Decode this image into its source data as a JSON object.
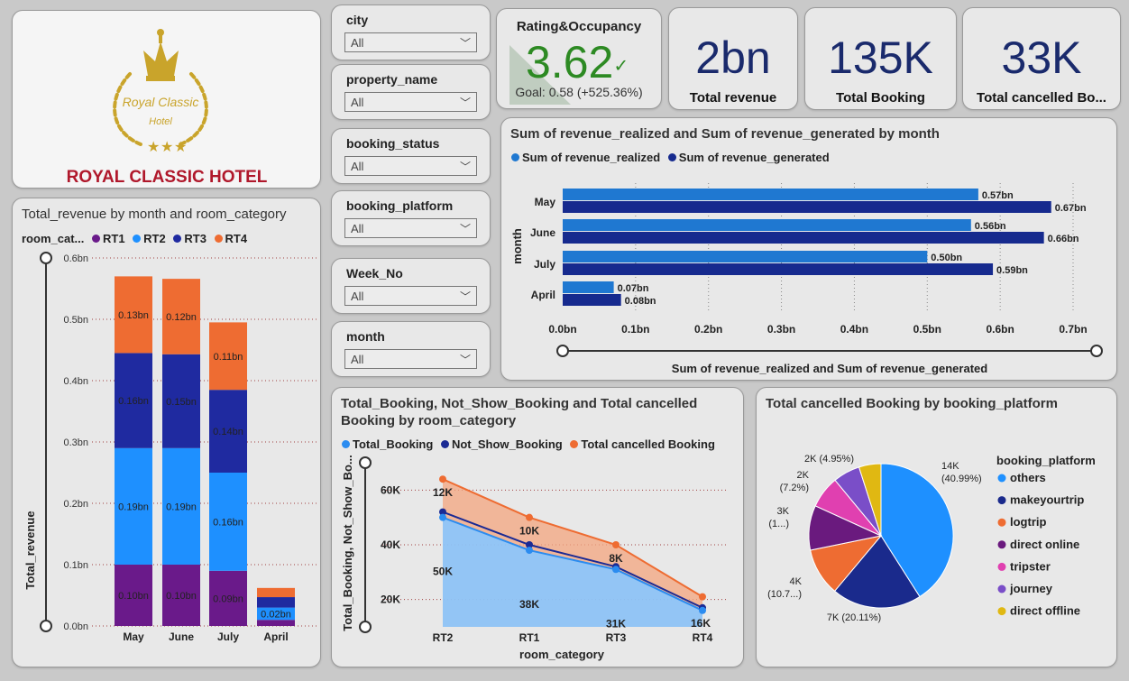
{
  "logo": {
    "brand": "ROYAL CLASSIC HOTEL",
    "emblem_line1": "Royal Classic",
    "emblem_line2": "Hotel",
    "colors": {
      "gold": "#c9a42b",
      "red": "#b0182b"
    }
  },
  "slicers": [
    {
      "label": "city",
      "value": "All"
    },
    {
      "label": "property_name",
      "value": "All"
    },
    {
      "label": "booking_status",
      "value": "All"
    },
    {
      "label": "booking_platform",
      "value": "All"
    },
    {
      "label": "Week_No",
      "value": "All"
    },
    {
      "label": "month",
      "value": "All"
    }
  ],
  "kpis": {
    "rating": {
      "title": "Rating&Occupancy",
      "value": "3.62",
      "check": "✓",
      "goal": "Goal: 0.58 (+525.36%)"
    },
    "revenue": {
      "value": "2bn",
      "label": "Total revenue"
    },
    "booking": {
      "value": "135K",
      "label": "Total Booking"
    },
    "cancelled": {
      "value": "33K",
      "label": "Total cancelled Bo..."
    }
  },
  "chart_data": [
    {
      "id": "revenue-stacked",
      "type": "bar",
      "title": "Total_revenue by month and room_category",
      "legend_title": "room_cat...",
      "ylabel": "Total_revenue",
      "categories": [
        "May",
        "June",
        "July",
        "April"
      ],
      "y_ticks": [
        "0.0bn",
        "0.1bn",
        "0.2bn",
        "0.3bn",
        "0.4bn",
        "0.5bn",
        "0.6bn"
      ],
      "ylim": [
        0,
        0.6
      ],
      "series": [
        {
          "name": "RT1",
          "color": "#6a1a8a",
          "values": [
            0.1,
            0.1,
            0.09,
            0.01
          ],
          "labels": [
            "0.10bn",
            "0.10bn",
            "0.09bn",
            ""
          ]
        },
        {
          "name": "RT2",
          "color": "#1e90ff",
          "values": [
            0.19,
            0.19,
            0.16,
            0.02
          ],
          "labels": [
            "0.19bn",
            "0.19bn",
            "0.16bn",
            "0.02bn"
          ]
        },
        {
          "name": "RT3",
          "color": "#1f2aa0",
          "values": [
            0.155,
            0.153,
            0.135,
            0.017
          ],
          "labels": [
            "0.16bn",
            "0.15bn",
            "0.14bn",
            ""
          ]
        },
        {
          "name": "RT4",
          "color": "#ee6c32",
          "values": [
            0.125,
            0.123,
            0.11,
            0.015
          ],
          "labels": [
            "0.13bn",
            "0.12bn",
            "0.11bn",
            ""
          ]
        }
      ]
    },
    {
      "id": "revenue-hbar",
      "type": "bar",
      "title": "Sum of revenue_realized and Sum of revenue_generated by month",
      "xlabel": "Sum of revenue_realized and Sum of revenue_generated",
      "ylabel": "month",
      "categories": [
        "May",
        "June",
        "July",
        "April"
      ],
      "x_ticks": [
        "0.0bn",
        "0.1bn",
        "0.2bn",
        "0.3bn",
        "0.4bn",
        "0.5bn",
        "0.6bn",
        "0.7bn"
      ],
      "xlim": [
        0,
        0.7
      ],
      "series": [
        {
          "name": "Sum of revenue_realized",
          "color": "#1f78d1",
          "values": [
            0.57,
            0.56,
            0.5,
            0.07
          ],
          "labels": [
            "0.57bn",
            "0.56bn",
            "0.50bn",
            "0.07bn"
          ]
        },
        {
          "name": "Sum of revenue_generated",
          "color": "#162a8e",
          "values": [
            0.67,
            0.66,
            0.59,
            0.08
          ],
          "labels": [
            "0.67bn",
            "0.66bn",
            "0.59bn",
            "0.08bn"
          ]
        }
      ]
    },
    {
      "id": "booking-area",
      "type": "area",
      "title": "Total_Booking, Not_Show_Booking and Total cancelled Booking by room_category",
      "xlabel": "room_category",
      "ylabel": "Total_Booking, Not_Show_Bo...",
      "categories": [
        "RT2",
        "RT1",
        "RT3",
        "RT4"
      ],
      "y_ticks": [
        "20K",
        "40K",
        "60K"
      ],
      "ylim": [
        10000,
        70000
      ],
      "series": [
        {
          "name": "Total_Booking",
          "color": "#2b8cf0",
          "values": [
            50000,
            38000,
            31000,
            16000
          ],
          "labels": [
            "50K",
            "38K",
            "31K",
            "16K"
          ]
        },
        {
          "name": "Not_Show_Booking",
          "color": "#1b2a94",
          "values": [
            52000,
            40000,
            32000,
            17000
          ]
        },
        {
          "name": "Total cancelled Booking",
          "color": "#ee6c32",
          "values": [
            64000,
            50000,
            40000,
            21000
          ],
          "labels": [
            "12K",
            "10K",
            "8K",
            ""
          ]
        }
      ]
    },
    {
      "id": "cancel-pie",
      "type": "pie",
      "title": "Total cancelled Booking by booking_platform",
      "legend_title": "booking_platform",
      "slices": [
        {
          "name": "others",
          "value": 40.99,
          "color": "#1e90ff",
          "label_a": "14K",
          "label_b": "(40.99%)"
        },
        {
          "name": "makeyourtrip",
          "value": 20.11,
          "color": "#1a2a8c",
          "label_a": "7K (20.11%)",
          "label_b": ""
        },
        {
          "name": "logtrip",
          "value": 10.7,
          "color": "#ee6c32",
          "label_a": "4K",
          "label_b": "(10.7...)"
        },
        {
          "name": "direct online",
          "value": 10.0,
          "color": "#6a1a7e",
          "label_a": "3K",
          "label_b": "(1...)"
        },
        {
          "name": "tripster",
          "value": 7.2,
          "color": "#e040b0",
          "label_a": "2K",
          "label_b": "(7.2%)"
        },
        {
          "name": "journey",
          "value": 6.05,
          "color": "#7a4ec8",
          "label_a": "",
          "label_b": ""
        },
        {
          "name": "direct offline",
          "value": 4.95,
          "color": "#e0b812",
          "label_a": "2K (4.95%)",
          "label_b": ""
        }
      ]
    }
  ]
}
